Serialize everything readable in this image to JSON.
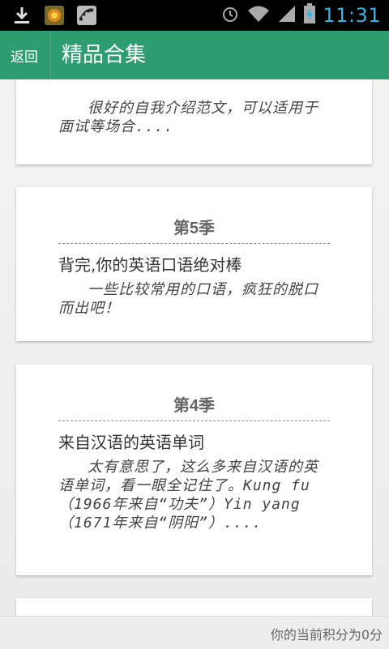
{
  "status_bar": {
    "time": "11:31",
    "icons": [
      "download-icon",
      "app-shield-icon",
      "pea-app-icon",
      "alarm-icon",
      "wifi-icon",
      "signal-icon",
      "battery-charging-icon"
    ]
  },
  "header": {
    "back_label": "返回",
    "title": "精品合集"
  },
  "cards": [
    {
      "season": "",
      "title": "",
      "desc": "很好的自我介绍范文，可以适用于面试等场合...."
    },
    {
      "season": "第5季",
      "title": "背完,你的英语口语绝对棒",
      "desc": "一些比较常用的口语，疯狂的脱口而出吧！"
    },
    {
      "season": "第4季",
      "title": "来自汉语的英语单词",
      "desc": "太有意思了，这么多来自汉语的英语单词，看一眼全记住了。Kung fu （1966年来自“功夫”）Yin yang （1671年来自“阴阳”）...."
    }
  ],
  "footer": {
    "score_text": "你的当前积分为0分"
  },
  "colors": {
    "titlebar": "#2e9e72",
    "clock": "#33b5e5"
  }
}
